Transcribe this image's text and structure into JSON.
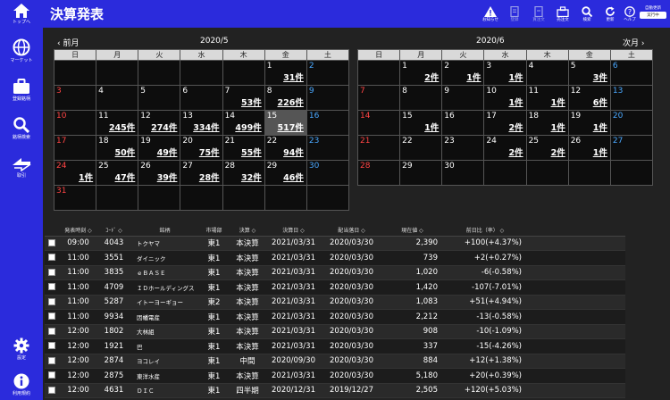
{
  "title": "決算発表",
  "sidebar": {
    "top": "トップへ",
    "market": "マーケット",
    "register": "登録銘柄",
    "search": "銘柄検索",
    "trade": "取引",
    "settings": "設定",
    "terms": "利用規約"
  },
  "toolbar": {
    "notice": "お知らせ",
    "register": "登録",
    "buy": "買注文",
    "sell": "売注文",
    "search": "検索",
    "refresh": "更新",
    "help": "ヘルプ",
    "auto_update": "自動更新",
    "run_button": "実行中"
  },
  "calendar": {
    "prev": "前月",
    "next": "次月",
    "weekdays": [
      "日",
      "月",
      "火",
      "水",
      "木",
      "金",
      "土"
    ],
    "left": {
      "title": "2020/5",
      "weeks": [
        [
          null,
          null,
          null,
          null,
          null,
          {
            "d": "1",
            "c": "31件"
          },
          {
            "d": "2"
          }
        ],
        [
          {
            "d": "3"
          },
          {
            "d": "4"
          },
          {
            "d": "5"
          },
          {
            "d": "6"
          },
          {
            "d": "7",
            "c": "53件"
          },
          {
            "d": "8",
            "c": "226件"
          },
          {
            "d": "9"
          }
        ],
        [
          {
            "d": "10"
          },
          {
            "d": "11",
            "c": "245件"
          },
          {
            "d": "12",
            "c": "274件"
          },
          {
            "d": "13",
            "c": "334件"
          },
          {
            "d": "14",
            "c": "499件"
          },
          {
            "d": "15",
            "c": "517件",
            "today": true
          },
          {
            "d": "16"
          }
        ],
        [
          {
            "d": "17"
          },
          {
            "d": "18",
            "c": "50件"
          },
          {
            "d": "19",
            "c": "49件"
          },
          {
            "d": "20",
            "c": "75件"
          },
          {
            "d": "21",
            "c": "55件"
          },
          {
            "d": "22",
            "c": "94件"
          },
          {
            "d": "23"
          }
        ],
        [
          {
            "d": "24",
            "c": "1件"
          },
          {
            "d": "25",
            "c": "47件"
          },
          {
            "d": "26",
            "c": "39件"
          },
          {
            "d": "27",
            "c": "28件"
          },
          {
            "d": "28",
            "c": "32件"
          },
          {
            "d": "29",
            "c": "46件"
          },
          {
            "d": "30"
          }
        ],
        [
          {
            "d": "31"
          },
          null,
          null,
          null,
          null,
          null,
          null
        ]
      ]
    },
    "right": {
      "title": "2020/6",
      "weeks": [
        [
          null,
          {
            "d": "1",
            "c": "2件"
          },
          {
            "d": "2",
            "c": "1件"
          },
          {
            "d": "3",
            "c": "1件"
          },
          {
            "d": "4"
          },
          {
            "d": "5",
            "c": "3件"
          },
          {
            "d": "6"
          }
        ],
        [
          {
            "d": "7"
          },
          {
            "d": "8"
          },
          {
            "d": "9"
          },
          {
            "d": "10",
            "c": "1件"
          },
          {
            "d": "11",
            "c": "1件"
          },
          {
            "d": "12",
            "c": "6件"
          },
          {
            "d": "13"
          }
        ],
        [
          {
            "d": "14"
          },
          {
            "d": "15",
            "c": "1件"
          },
          {
            "d": "16"
          },
          {
            "d": "17",
            "c": "2件"
          },
          {
            "d": "18",
            "c": "1件"
          },
          {
            "d": "19",
            "c": "1件"
          },
          {
            "d": "20"
          }
        ],
        [
          {
            "d": "21"
          },
          {
            "d": "22"
          },
          {
            "d": "23"
          },
          {
            "d": "24",
            "c": "2件"
          },
          {
            "d": "25",
            "c": "2件"
          },
          {
            "d": "26",
            "c": "1件"
          },
          {
            "d": "27"
          }
        ],
        [
          {
            "d": "28"
          },
          {
            "d": "29"
          },
          {
            "d": "30"
          },
          null,
          null,
          null,
          null
        ]
      ]
    }
  },
  "results": {
    "headers": [
      "発表時刻",
      "ｺｰﾄﾞ",
      "銘柄",
      "市場部",
      "決算",
      "決算日",
      "配当落日",
      "現在値",
      "前日比（率）"
    ],
    "rows": [
      {
        "time": "09:00",
        "code": "4043",
        "name": "トクヤマ",
        "market": "東1",
        "type": "本決算",
        "date": "2021/03/31",
        "exdiv": "2020/03/30",
        "price": "2,390",
        "change": "+100(+4.37%)",
        "dir": "up"
      },
      {
        "time": "11:00",
        "code": "3551",
        "name": "ダイニック",
        "market": "東1",
        "type": "本決算",
        "date": "2021/03/31",
        "exdiv": "2020/03/30",
        "price": "739",
        "change": "+2(+0.27%)",
        "dir": "up"
      },
      {
        "time": "11:00",
        "code": "3835",
        "name": "ｅＢＡＳＥ",
        "market": "東1",
        "type": "本決算",
        "date": "2021/03/31",
        "exdiv": "2020/03/30",
        "price": "1,020",
        "change": "-6(-0.58%)",
        "dir": "dn"
      },
      {
        "time": "11:00",
        "code": "4709",
        "name": "ＩＤホールディングス",
        "market": "東1",
        "type": "本決算",
        "date": "2021/03/31",
        "exdiv": "2020/03/30",
        "price": "1,420",
        "change": "-107(-7.01%)",
        "dir": "dn"
      },
      {
        "time": "11:00",
        "code": "5287",
        "name": "イトーヨーギョー",
        "market": "東2",
        "type": "本決算",
        "date": "2021/03/31",
        "exdiv": "2020/03/30",
        "price": "1,083",
        "change": "+51(+4.94%)",
        "dir": "up"
      },
      {
        "time": "11:00",
        "code": "9934",
        "name": "因幡電産",
        "market": "東1",
        "type": "本決算",
        "date": "2021/03/31",
        "exdiv": "2020/03/30",
        "price": "2,212",
        "change": "-13(-0.58%)",
        "dir": "dn"
      },
      {
        "time": "12:00",
        "code": "1802",
        "name": "大林組",
        "market": "東1",
        "type": "本決算",
        "date": "2021/03/31",
        "exdiv": "2020/03/30",
        "price": "908",
        "change": "-10(-1.09%)",
        "dir": "dn"
      },
      {
        "time": "12:00",
        "code": "1921",
        "name": "巴",
        "market": "東1",
        "type": "本決算",
        "date": "2021/03/31",
        "exdiv": "2020/03/30",
        "price": "337",
        "change": "-15(-4.26%)",
        "dir": "dn"
      },
      {
        "time": "12:00",
        "code": "2874",
        "name": "ヨコレイ",
        "market": "東1",
        "type": "中間",
        "date": "2020/09/30",
        "exdiv": "2020/03/30",
        "price": "884",
        "change": "+12(+1.38%)",
        "dir": "up"
      },
      {
        "time": "12:00",
        "code": "2875",
        "name": "東洋水産",
        "market": "東1",
        "type": "本決算",
        "date": "2021/03/31",
        "exdiv": "2020/03/30",
        "price": "5,180",
        "change": "+20(+0.39%)",
        "dir": "up"
      },
      {
        "time": "12:00",
        "code": "4631",
        "name": "ＤＩＣ",
        "market": "東1",
        "type": "四半期",
        "date": "2020/12/31",
        "exdiv": "2019/12/27",
        "price": "2,505",
        "change": "+120(+5.03%)",
        "dir": "up"
      }
    ]
  }
}
